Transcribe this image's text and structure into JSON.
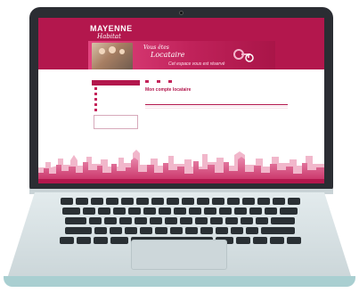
{
  "site": {
    "logo_main": "MAYENNE",
    "logo_sub": "Habitat",
    "tagline_line1": "Vous êtes",
    "tagline_line2": "Locataire",
    "tagline_line3": "Cet espace vous est réservé",
    "header_contact": "",
    "breadcrumb": "",
    "sidebar": {
      "title": "",
      "items": [
        "",
        "",
        "",
        "",
        ""
      ]
    },
    "content": {
      "toolbar": [
        "",
        "",
        ""
      ],
      "title": "Mon compte locataire",
      "subtitle": "",
      "fields": [
        {
          "label": "",
          "value": "",
          "label2": "",
          "value2": ""
        },
        {
          "label": "",
          "value": "",
          "label2": "",
          "value2": ""
        },
        {
          "label": "",
          "value": "",
          "label2": "",
          "value2": ""
        },
        {
          "label": "",
          "value": "",
          "label2": "",
          "value2": ""
        }
      ],
      "balance_label": "",
      "note": "",
      "table_headers": [
        "",
        "",
        "",
        "",
        ""
      ],
      "table_rows": [
        [
          "",
          "",
          "",
          "",
          ""
        ],
        [
          "",
          "",
          "",
          "",
          ""
        ],
        [
          "",
          "",
          "",
          "",
          ""
        ],
        [
          "",
          "",
          "",
          "",
          ""
        ]
      ]
    }
  },
  "colors": {
    "brand": "#b3174d",
    "accent": "#e2457f",
    "bezel": "#2b2d33",
    "deck": "#dfe7e9"
  },
  "icons": [
    "camera-icon",
    "keys-icon",
    "print-icon",
    "envelope-icon"
  ]
}
